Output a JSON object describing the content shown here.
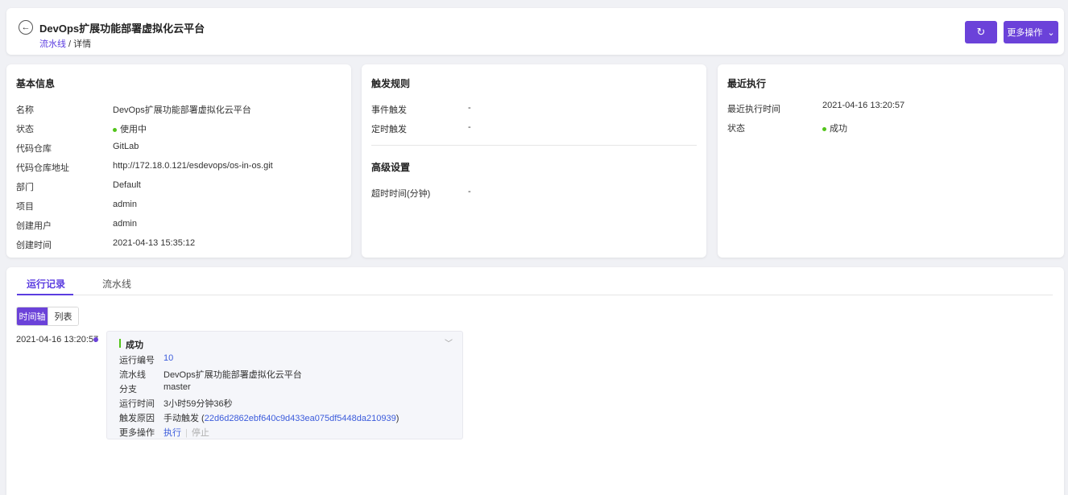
{
  "header": {
    "title": "DevOps扩展功能部署虚拟化云平台",
    "breadcrumb_link": "流水线",
    "breadcrumb_sep": " / ",
    "breadcrumb_current": "详情",
    "more_actions_label": "更多操作"
  },
  "basic": {
    "title": "基本信息",
    "rows": [
      {
        "label": "名称",
        "value": "DevOps扩展功能部署虚拟化云平台"
      },
      {
        "label": "状态",
        "value": "使用中"
      },
      {
        "label": "代码仓库",
        "value": "GitLab"
      },
      {
        "label": "代码仓库地址",
        "value": "http://172.18.0.121/esdevops/os-in-os.git"
      },
      {
        "label": "部门",
        "value": "Default"
      },
      {
        "label": "项目",
        "value": "admin"
      },
      {
        "label": "创建用户",
        "value": "admin"
      },
      {
        "label": "创建时间",
        "value": "2021-04-13 15:35:12"
      }
    ]
  },
  "trigger": {
    "title": "触发规则",
    "rows": [
      {
        "label": "事件触发",
        "value": "-"
      },
      {
        "label": "定时触发",
        "value": "-"
      }
    ],
    "advanced_title": "高级设置",
    "advanced_rows": [
      {
        "label": "超时时间(分钟)",
        "value": "-"
      }
    ]
  },
  "recent": {
    "title": "最近执行",
    "rows": [
      {
        "label": "最近执行时间",
        "value": "2021-04-16 13:20:57"
      },
      {
        "label": "状态",
        "value": "成功"
      }
    ]
  },
  "bottom": {
    "tabs": [
      {
        "label": "运行记录",
        "active": true
      },
      {
        "label": "流水线",
        "active": false
      }
    ],
    "view_toggle": [
      {
        "label": "时间轴",
        "active": true
      },
      {
        "label": "列表",
        "active": false
      }
    ],
    "timeline": {
      "time": "2021-04-16 13:20:57",
      "status": "成功",
      "run_no_label": "运行编号",
      "run_no": "10",
      "pipeline_label": "流水线",
      "pipeline": "DevOps扩展功能部署虚拟化云平台",
      "branch_label": "分支",
      "branch": "master",
      "duration_label": "运行时间",
      "duration": "3小时59分钟36秒",
      "reason_label": "触发原因",
      "reason_text": "手动触发",
      "reason_open": " (",
      "commit": "22d6d2862ebf640c9d433ea075df5448da210939",
      "reason_close": ")",
      "actions_label": "更多操作",
      "action_run": "执行",
      "action_stop": "停止"
    }
  },
  "colors": {
    "primary": "#6b42d9",
    "success": "#52c41a",
    "link": "#3b5bdb"
  }
}
